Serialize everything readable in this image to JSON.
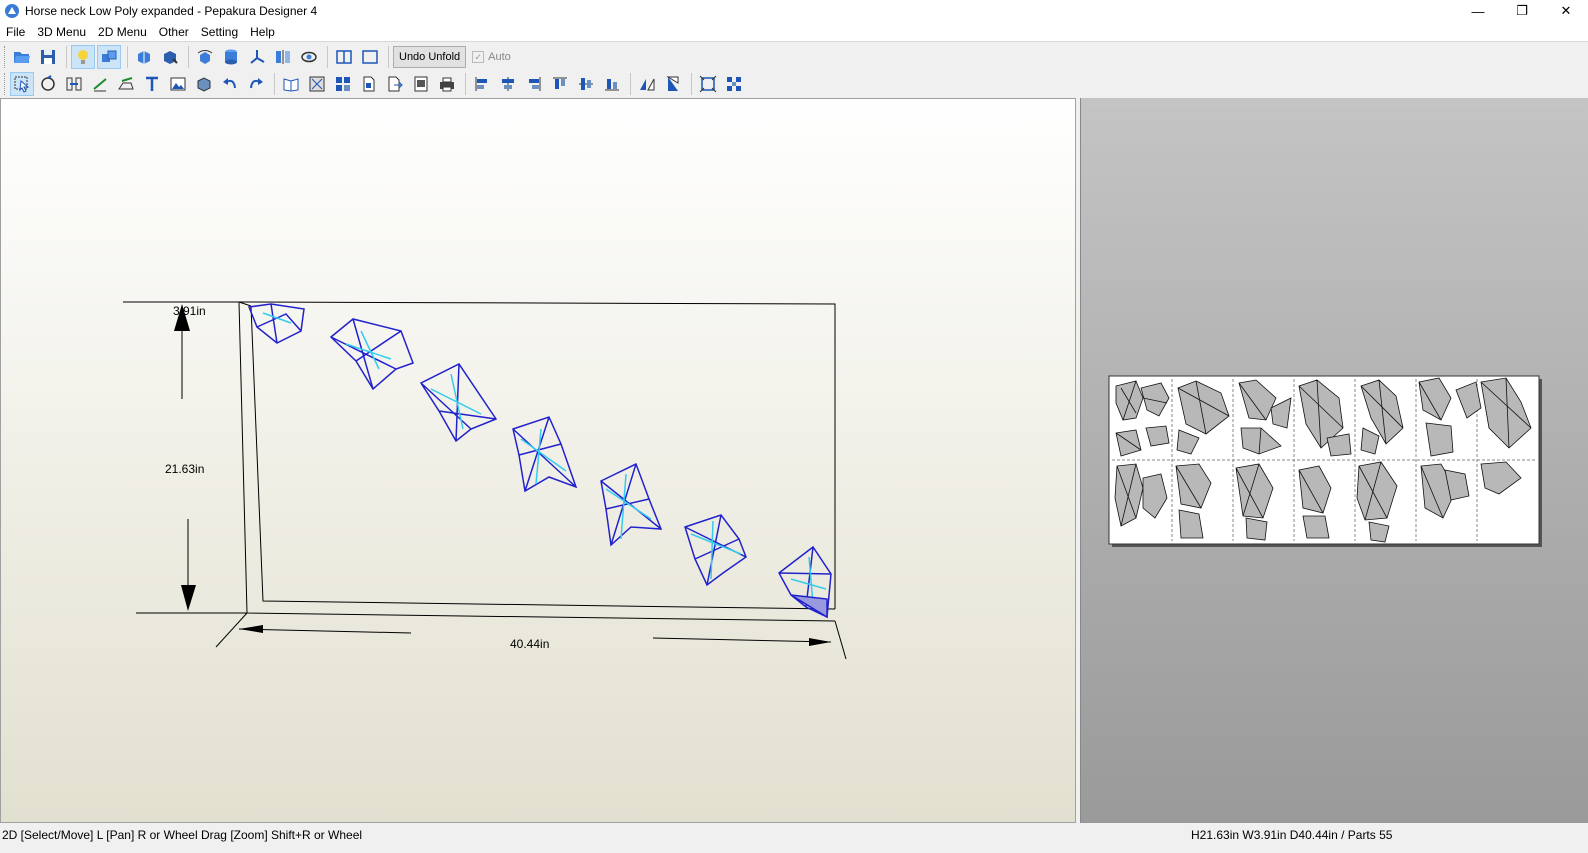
{
  "window": {
    "title": "Horse neck Low Poly expanded - Pepakura Designer 4",
    "minimize": "—",
    "restore": "❐",
    "close": "✕"
  },
  "menu": [
    "File",
    "3D Menu",
    "2D Menu",
    "Other",
    "Setting",
    "Help"
  ],
  "toolbar1": {
    "undo_unfold_label": "Undo Unfold",
    "auto_label": "Auto",
    "auto_check": "✓"
  },
  "view3d": {
    "height_label": "21.63in",
    "width_label": "3.91in",
    "depth_label": "40.44in"
  },
  "status": {
    "left": "2D [Select/Move] L [Pan] R or Wheel Drag [Zoom] Shift+R or Wheel",
    "right": "H21.63in W3.91in D40.44in / Parts 55"
  },
  "colors": {
    "wire_dark": "#2222cc",
    "wire_light": "#33ccee",
    "part_fill": "#b8b8b8"
  }
}
